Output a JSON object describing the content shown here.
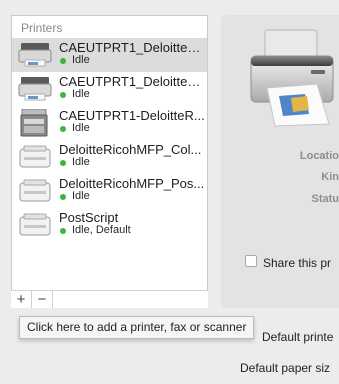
{
  "list": {
    "header": "Printers",
    "printers": [
      {
        "name": "CAEUTPRT1_DeloitteR...",
        "status": "Idle",
        "icon": "wide-format-printer-icon",
        "selected": true
      },
      {
        "name": "CAEUTPRT1_DeloitteR...",
        "status": "Idle",
        "icon": "wide-format-printer-icon",
        "selected": false
      },
      {
        "name": "CAEUTPRT1-DeloitteR...",
        "status": "Idle",
        "icon": "multifunction-copier-icon",
        "selected": false
      },
      {
        "name": "DeloitteRicohMFP_Col...",
        "status": "Idle",
        "icon": "laser-printer-icon",
        "selected": false
      },
      {
        "name": "DeloitteRicohMFP_Pos...",
        "status": "Idle",
        "icon": "laser-printer-icon",
        "selected": false
      },
      {
        "name": "PostScript",
        "status": "Idle, Default",
        "icon": "laser-printer-icon",
        "selected": false
      }
    ]
  },
  "toolbar": {
    "add_label": "+",
    "remove_label": "−"
  },
  "tooltip": {
    "text": "Click here to add a printer, fax or scanner"
  },
  "detail": {
    "location_label": "Locatio",
    "kind_label": "Kin",
    "status_label": "Statu",
    "share_label": "Share this pr",
    "share_checked": false
  },
  "footer": {
    "default_printer_label": "Default printe",
    "default_paper_label": "Default paper siz"
  },
  "colors": {
    "status_idle": "#3fb23f",
    "selection": "#dcdcdc"
  }
}
